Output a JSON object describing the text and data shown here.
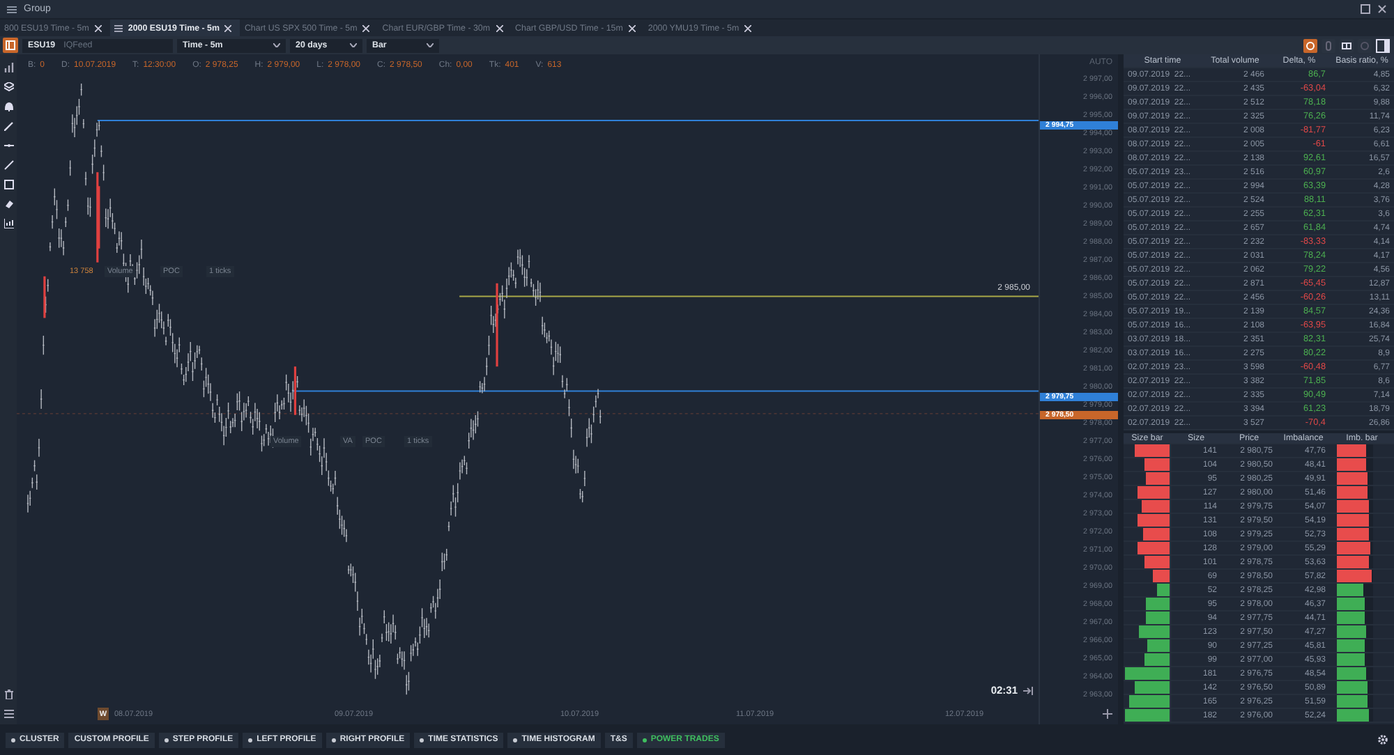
{
  "window": {
    "title": "Group"
  },
  "tabs": [
    {
      "label": "800 ESU19 Time - 5m",
      "selected": false
    },
    {
      "label": "2000 ESU19 Time - 5m",
      "selected": true
    },
    {
      "label": "Chart US SPX 500 Time - 5m",
      "selected": false
    },
    {
      "label": "Chart EUR/GBP Time - 30m",
      "selected": false
    },
    {
      "label": "Chart GBP/USD Time - 15m",
      "selected": false
    },
    {
      "label": "2000 YMU19 Time - 5m",
      "selected": false
    }
  ],
  "toolbar": {
    "symbol": "ESU19",
    "feed": "IQFeed",
    "timeframe": "Time - 5m",
    "period": "20 days",
    "chart_type": "Bar"
  },
  "info_line": [
    {
      "key": "B:",
      "value": "0"
    },
    {
      "key": "D:",
      "value": "10.07.2019"
    },
    {
      "key": "T:",
      "value": "12:30:00"
    },
    {
      "key": "O:",
      "value": "2 978,25"
    },
    {
      "key": "H:",
      "value": "2 979,00"
    },
    {
      "key": "L:",
      "value": "2 978,00"
    },
    {
      "key": "C:",
      "value": "2 978,50"
    },
    {
      "key": "Ch:",
      "value": "0,00"
    },
    {
      "key": "Tk:",
      "value": "401"
    },
    {
      "key": "V:",
      "value": "613"
    }
  ],
  "chart_labels": [
    {
      "items": [
        "13 758",
        "Volume",
        "POC",
        "1 ticks"
      ]
    },
    {
      "items": [
        "Volume",
        "VA",
        "POC",
        "1 ticks"
      ]
    }
  ],
  "chart_levels": [
    {
      "label": "2 985,00"
    }
  ],
  "price_axis": {
    "mode": "AUTO",
    "labels": [
      "2 997,00",
      "2 996,00",
      "2 995,00",
      "2 994,00",
      "2 993,00",
      "2 992,00",
      "2 991,00",
      "2 990,00",
      "2 989,00",
      "2 988,00",
      "2 987,00",
      "2 986,00",
      "2 985,00",
      "2 984,00",
      "2 983,00",
      "2 982,00",
      "2 981,00",
      "2 980,00",
      "2 979,00",
      "2 978,00",
      "2 977,00",
      "2 976,00",
      "2 975,00",
      "2 974,00",
      "2 973,00",
      "2 972,00",
      "2 971,00",
      "2 970,00",
      "2 969,00",
      "2 968,00",
      "2 967,00",
      "2 966,00",
      "2 965,00",
      "2 964,00",
      "2 963,00"
    ]
  },
  "price_marks": [
    {
      "label": "2 994,75",
      "color": "#2f80d8"
    },
    {
      "label": "2 979,75",
      "color": "#2f80d8"
    },
    {
      "label": "2 978,50",
      "color": "#c8662a"
    }
  ],
  "date_axis": {
    "week_badge": "W",
    "labels": [
      "08.07.2019",
      "09.07.2019",
      "10.07.2019",
      "11.07.2019",
      "12.07.2019"
    ]
  },
  "timer": "02:31",
  "trades_table": {
    "columns": [
      "Start time",
      "Total volume",
      "Delta, %",
      "Basis ratio, %"
    ],
    "rows": [
      {
        "start": "09.07.2019  22...",
        "volume": "2 466",
        "delta": "86,7",
        "ratio": "4,85",
        "color": "#4caf50"
      },
      {
        "start": "09.07.2019  22...",
        "volume": "2 435",
        "delta": "-63,04",
        "ratio": "6,32",
        "color": "#e04848"
      },
      {
        "start": "09.07.2019  22...",
        "volume": "2 512",
        "delta": "78,18",
        "ratio": "9,88",
        "color": "#4caf50"
      },
      {
        "start": "09.07.2019  22...",
        "volume": "2 325",
        "delta": "76,26",
        "ratio": "11,74",
        "color": "#4caf50"
      },
      {
        "start": "08.07.2019  22...",
        "volume": "2 008",
        "delta": "-81,77",
        "ratio": "6,23",
        "color": "#e04848"
      },
      {
        "start": "08.07.2019  22...",
        "volume": "2 005",
        "delta": "-61",
        "ratio": "6,61",
        "color": "#e04848"
      },
      {
        "start": "08.07.2019  22...",
        "volume": "2 138",
        "delta": "92,61",
        "ratio": "16,57",
        "color": "#4caf50"
      },
      {
        "start": "05.07.2019  23...",
        "volume": "2 516",
        "delta": "60,97",
        "ratio": "2,6",
        "color": "#4caf50"
      },
      {
        "start": "05.07.2019  22...",
        "volume": "2 994",
        "delta": "63,39",
        "ratio": "4,28",
        "color": "#4caf50"
      },
      {
        "start": "05.07.2019  22...",
        "volume": "2 524",
        "delta": "88,11",
        "ratio": "3,76",
        "color": "#4caf50"
      },
      {
        "start": "05.07.2019  22...",
        "volume": "2 255",
        "delta": "62,31",
        "ratio": "3,6",
        "color": "#4caf50"
      },
      {
        "start": "05.07.2019  22...",
        "volume": "2 657",
        "delta": "61,84",
        "ratio": "4,74",
        "color": "#4caf50"
      },
      {
        "start": "05.07.2019  22...",
        "volume": "2 232",
        "delta": "-83,33",
        "ratio": "4,14",
        "color": "#e04848"
      },
      {
        "start": "05.07.2019  22...",
        "volume": "2 031",
        "delta": "78,24",
        "ratio": "4,17",
        "color": "#4caf50"
      },
      {
        "start": "05.07.2019  22...",
        "volume": "2 062",
        "delta": "79,22",
        "ratio": "4,56",
        "color": "#4caf50"
      },
      {
        "start": "05.07.2019  22...",
        "volume": "2 871",
        "delta": "-65,45",
        "ratio": "12,87",
        "color": "#e04848"
      },
      {
        "start": "05.07.2019  22...",
        "volume": "2 456",
        "delta": "-60,26",
        "ratio": "13,11",
        "color": "#e04848"
      },
      {
        "start": "05.07.2019  19...",
        "volume": "2 139",
        "delta": "84,57",
        "ratio": "24,36",
        "color": "#4caf50"
      },
      {
        "start": "05.07.2019  16...",
        "volume": "2 108",
        "delta": "-63,95",
        "ratio": "16,84",
        "color": "#e04848"
      },
      {
        "start": "03.07.2019  18...",
        "volume": "2 351",
        "delta": "82,31",
        "ratio": "25,74",
        "color": "#4caf50"
      },
      {
        "start": "03.07.2019  16...",
        "volume": "2 275",
        "delta": "80,22",
        "ratio": "8,9",
        "color": "#4caf50"
      },
      {
        "start": "02.07.2019  23...",
        "volume": "3 598",
        "delta": "-60,48",
        "ratio": "6,77",
        "color": "#e04848"
      },
      {
        "start": "02.07.2019  22...",
        "volume": "3 382",
        "delta": "71,85",
        "ratio": "8,6",
        "color": "#4caf50"
      },
      {
        "start": "02.07.2019  22...",
        "volume": "2 335",
        "delta": "90,49",
        "ratio": "7,14",
        "color": "#4caf50"
      },
      {
        "start": "02.07.2019  22...",
        "volume": "3 394",
        "delta": "61,23",
        "ratio": "18,79",
        "color": "#4caf50"
      },
      {
        "start": "02.07.2019  22...",
        "volume": "3 527",
        "delta": "-70,4",
        "ratio": "26,86",
        "color": "#e04848"
      }
    ]
  },
  "levels_table": {
    "columns": [
      "Size bar",
      "Size",
      "Price",
      "Imbalance",
      "Imb. bar"
    ],
    "rows": [
      {
        "size": "141",
        "price": "2 980,75",
        "imbalance": "47,76",
        "color": "#e84c4c",
        "size_bar": {
          "level": 0.76
        },
        "imbalance_bar": {
          "level": 0.8
        }
      },
      {
        "size": "104",
        "price": "2 980,50",
        "imbalance": "48,41",
        "color": "#e84c4c",
        "size_bar": {
          "level": 0.56
        },
        "imbalance_bar": {
          "level": 0.81
        }
      },
      {
        "size": "95",
        "price": "2 980,25",
        "imbalance": "49,91",
        "color": "#e84c4c",
        "size_bar": {
          "level": 0.51
        },
        "imbalance_bar": {
          "level": 0.83
        }
      },
      {
        "size": "127",
        "price": "2 980,00",
        "imbalance": "51,46",
        "color": "#e84c4c",
        "size_bar": {
          "level": 0.69
        },
        "imbalance_bar": {
          "level": 0.86
        }
      },
      {
        "size": "114",
        "price": "2 979,75",
        "imbalance": "54,07",
        "color": "#e84c4c",
        "size_bar": {
          "level": 0.62
        },
        "imbalance_bar": {
          "level": 0.9
        }
      },
      {
        "size": "131",
        "price": "2 979,50",
        "imbalance": "54,19",
        "color": "#e84c4c",
        "size_bar": {
          "level": 0.71
        },
        "imbalance_bar": {
          "level": 0.9
        }
      },
      {
        "size": "108",
        "price": "2 979,25",
        "imbalance": "52,73",
        "color": "#e84c4c",
        "size_bar": {
          "level": 0.58
        },
        "imbalance_bar": {
          "level": 0.88
        }
      },
      {
        "size": "128",
        "price": "2 979,00",
        "imbalance": "55,29",
        "color": "#e84c4c",
        "size_bar": {
          "level": 0.69
        },
        "imbalance_bar": {
          "level": 0.92
        }
      },
      {
        "size": "101",
        "price": "2 978,75",
        "imbalance": "53,63",
        "color": "#e84c4c",
        "size_bar": {
          "level": 0.55
        },
        "imbalance_bar": {
          "level": 0.89
        }
      },
      {
        "size": "69",
        "price": "2 978,50",
        "imbalance": "57,82",
        "color": "#e84c4c",
        "size_bar": {
          "level": 0.37
        },
        "imbalance_bar": {
          "level": 0.96
        }
      },
      {
        "size": "52",
        "price": "2 978,25",
        "imbalance": "42,98",
        "color": "#3fae55",
        "size_bar": {
          "level": 0.28
        },
        "imbalance_bar": {
          "level": 0.72
        }
      },
      {
        "size": "95",
        "price": "2 978,00",
        "imbalance": "46,37",
        "color": "#3fae55",
        "size_bar": {
          "level": 0.51
        },
        "imbalance_bar": {
          "level": 0.77
        }
      },
      {
        "size": "94",
        "price": "2 977,75",
        "imbalance": "44,71",
        "color": "#3fae55",
        "size_bar": {
          "level": 0.51
        },
        "imbalance_bar": {
          "level": 0.75
        }
      },
      {
        "size": "123",
        "price": "2 977,50",
        "imbalance": "47,27",
        "color": "#3fae55",
        "size_bar": {
          "level": 0.66
        },
        "imbalance_bar": {
          "level": 0.79
        }
      },
      {
        "size": "90",
        "price": "2 977,25",
        "imbalance": "45,81",
        "color": "#3fae55",
        "size_bar": {
          "level": 0.49
        },
        "imbalance_bar": {
          "level": 0.76
        }
      },
      {
        "size": "99",
        "price": "2 977,00",
        "imbalance": "45,93",
        "color": "#3fae55",
        "size_bar": {
          "level": 0.54
        },
        "imbalance_bar": {
          "level": 0.77
        }
      },
      {
        "size": "181",
        "price": "2 976,75",
        "imbalance": "48,54",
        "color": "#3fae55",
        "size_bar": {
          "level": 0.98
        },
        "imbalance_bar": {
          "level": 0.81
        }
      },
      {
        "size": "142",
        "price": "2 976,50",
        "imbalance": "50,89",
        "color": "#3fae55",
        "size_bar": {
          "level": 0.77
        },
        "imbalance_bar": {
          "level": 0.85
        }
      },
      {
        "size": "165",
        "price": "2 976,25",
        "imbalance": "51,59",
        "color": "#3fae55",
        "size_bar": {
          "level": 0.89
        },
        "imbalance_bar": {
          "level": 0.86
        }
      },
      {
        "size": "182",
        "price": "2 976,00",
        "imbalance": "52,24",
        "color": "#3fae55",
        "size_bar": {
          "level": 0.98
        },
        "imbalance_bar": {
          "level": 0.87
        }
      }
    ]
  },
  "bottom_tabs": [
    {
      "label": "CLUSTER",
      "dot": true,
      "selected": false
    },
    {
      "label": "CUSTOM PROFILE",
      "dot": false,
      "selected": false
    },
    {
      "label": "STEP PROFILE",
      "dot": true,
      "selected": false
    },
    {
      "label": "LEFT PROFILE",
      "dot": true,
      "selected": false
    },
    {
      "label": "RIGHT PROFILE",
      "dot": true,
      "selected": false
    },
    {
      "label": "TIME STATISTICS",
      "dot": true,
      "selected": false
    },
    {
      "label": "TIME HISTOGRAM",
      "dot": true,
      "selected": false
    },
    {
      "label": "T&S",
      "dot": false,
      "selected": false
    },
    {
      "label": "POWER TRADES",
      "dot": true,
      "selected": true
    }
  ]
}
